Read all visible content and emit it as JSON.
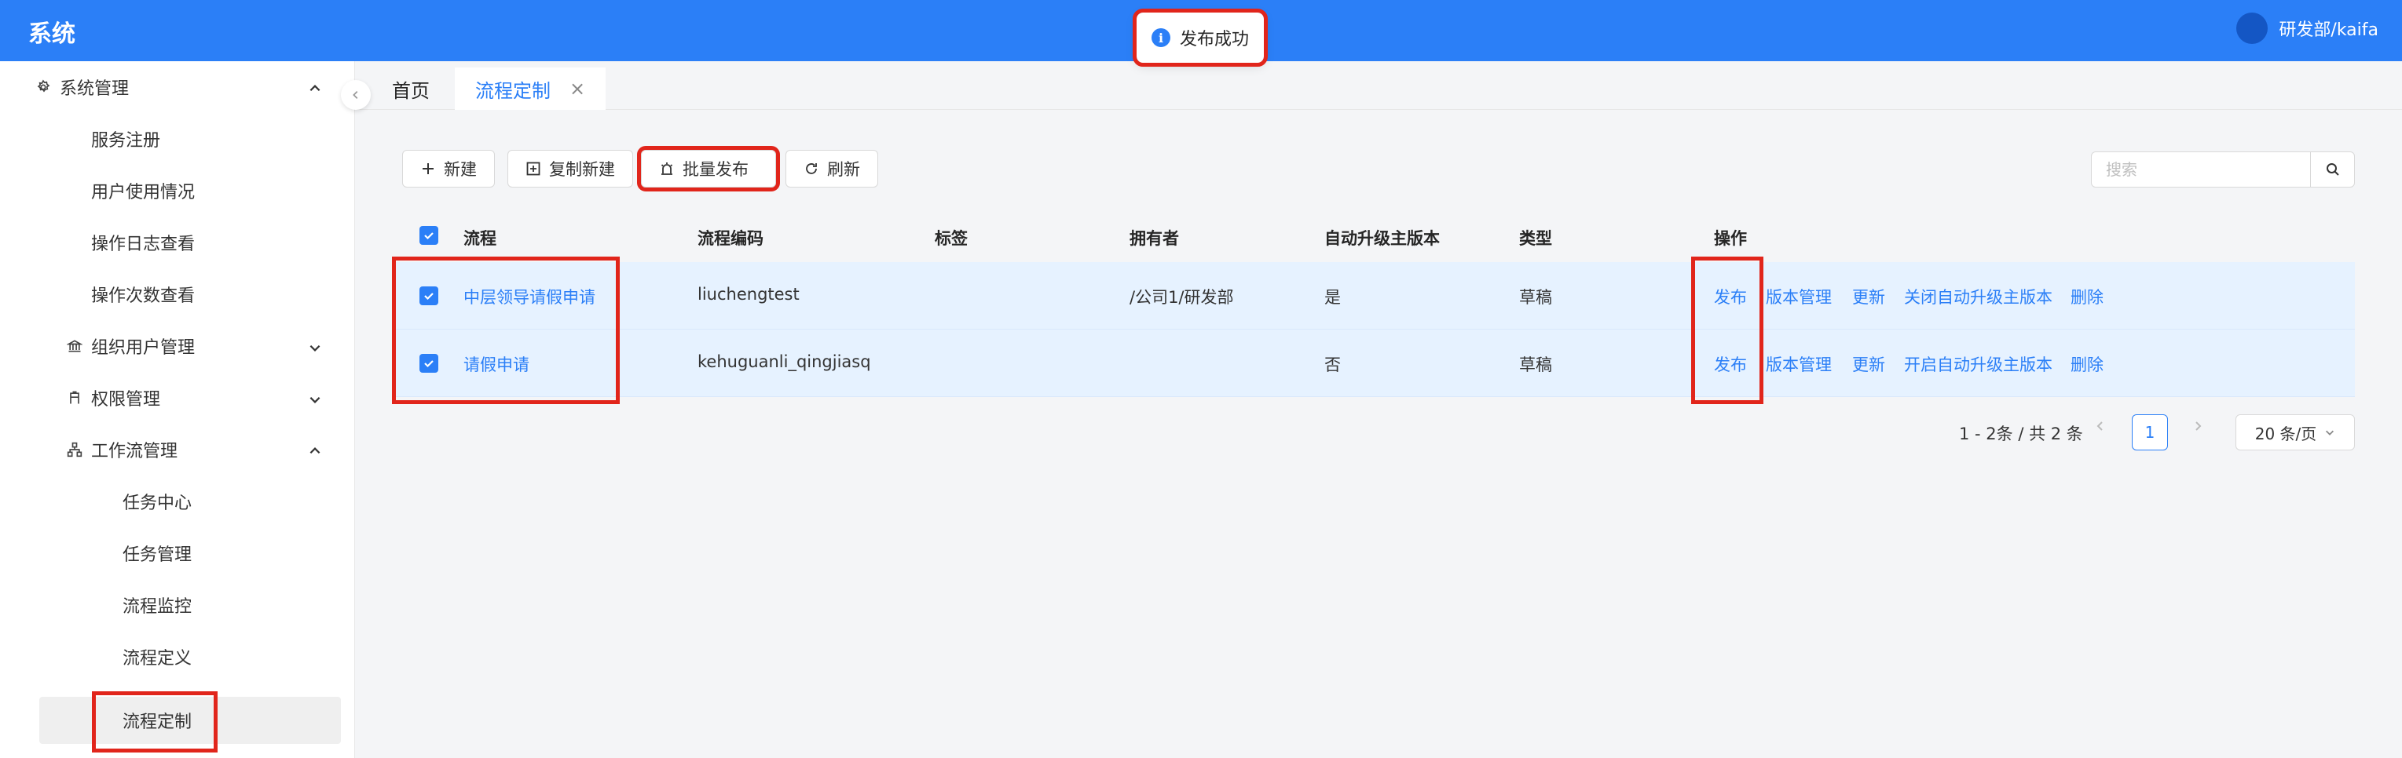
{
  "header": {
    "title": "系统",
    "user": "研发部/kaifa"
  },
  "toast": {
    "message": "发布成功"
  },
  "sidebar": {
    "system_mgmt": "系统管理",
    "service_reg": "服务注册",
    "user_usage": "用户使用情况",
    "op_log": "操作日志查看",
    "op_count": "操作次数查看",
    "org_user": "组织用户管理",
    "perm": "权限管理",
    "workflow": "工作流管理",
    "task_center": "任务中心",
    "task_mgmt": "任务管理",
    "flow_monitor": "流程监控",
    "flow_def": "流程定义",
    "flow_custom": "流程定制"
  },
  "tabs": {
    "home": "首页",
    "current": "流程定制"
  },
  "toolbar": {
    "new": "新建",
    "copy_new": "复制新建",
    "batch_publish": "批量发布",
    "refresh": "刷新",
    "search_placeholder": "搜索"
  },
  "table": {
    "headers": {
      "flow": "流程",
      "code": "流程编码",
      "tag": "标签",
      "owner": "拥有者",
      "auto_upgrade": "自动升级主版本",
      "type": "类型",
      "actions": "操作"
    },
    "rows": [
      {
        "name": "中层领导请假申请",
        "code": "liuchengtest",
        "tag": "",
        "owner": "/公司1/研发部",
        "auto_upgrade": "是",
        "type": "草稿",
        "a_publish": "发布",
        "a_version": "版本管理",
        "a_update": "更新",
        "a_toggle": "关闭自动升级主版本",
        "a_delete": "删除"
      },
      {
        "name": "请假申请",
        "code": "kehuguanli_qingjiasq",
        "tag": "",
        "owner": "",
        "auto_upgrade": "否",
        "type": "草稿",
        "a_publish": "发布",
        "a_version": "版本管理",
        "a_update": "更新",
        "a_toggle": "开启自动升级主版本",
        "a_delete": "删除"
      }
    ]
  },
  "pagination": {
    "summary": "1 - 2条 / 共 2 条",
    "current": "1",
    "page_size": "20 条/页"
  },
  "colors": {
    "primary": "#2b7ff7",
    "highlight": "#e1251b",
    "row_selected": "#e6f2ff"
  }
}
